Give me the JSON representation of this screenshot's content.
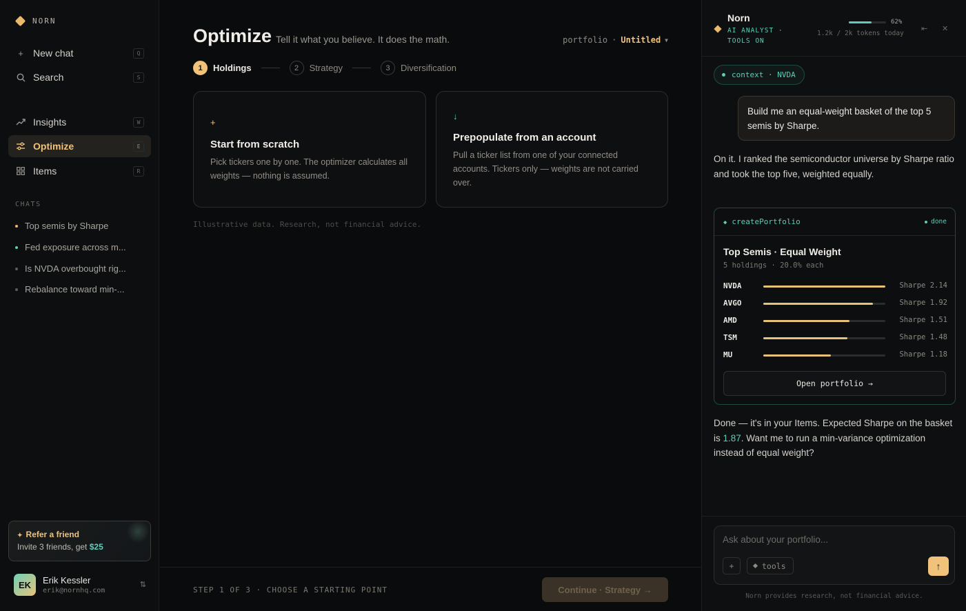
{
  "brand": {
    "name": "NORN"
  },
  "nav": {
    "new_chat": {
      "label": "New chat",
      "kbd": "Q"
    },
    "search": {
      "label": "Search",
      "kbd": "S"
    },
    "insights": {
      "label": "Insights",
      "kbd": "W"
    },
    "optimize": {
      "label": "Optimize",
      "kbd": "E"
    },
    "items": {
      "label": "Items",
      "kbd": "R"
    }
  },
  "chats": {
    "heading": "CHATS",
    "items": [
      {
        "label": "Top semis by Sharpe",
        "dot": "#e9b96e"
      },
      {
        "label": "Fed exposure across m...",
        "dot": "#5fcdb8"
      },
      {
        "label": "Is NVDA overbought rig...",
        "dot": "#5f5c57"
      },
      {
        "label": "Rebalance toward min-...",
        "dot": "#5f5c57"
      }
    ]
  },
  "refer": {
    "title": "Refer a friend",
    "text": "Invite 3 friends, get",
    "amount": "$25",
    "icon": "sparkle-icon"
  },
  "user": {
    "initials": "EK",
    "name": "Erik Kessler",
    "email": "erik@nornhq.com"
  },
  "main": {
    "title": "Optimize",
    "subtitle": "Tell it what you believe. It does the math.",
    "portfolio_label": "portfolio",
    "portfolio_sep": "·",
    "portfolio_name": "Untitled",
    "steps": [
      {
        "num": "1",
        "label": "Holdings"
      },
      {
        "num": "2",
        "label": "Strategy"
      },
      {
        "num": "3",
        "label": "Diversification"
      }
    ],
    "cards": [
      {
        "icon": "+",
        "title": "Start from scratch",
        "desc": "Pick tickers one by one. The optimizer calculates all weights — nothing is assumed."
      },
      {
        "icon": "↓",
        "title": "Prepopulate from an account",
        "desc": "Pull a ticker list from one of your connected accounts. Tickers only — weights are not carried over."
      }
    ],
    "disclaimer": "Illustrative data. Research, not financial advice.",
    "footer_text": "STEP 1 OF 3 · CHOOSE A STARTING POINT",
    "continue_label": "Continue · Strategy →"
  },
  "panel": {
    "name": "Norn",
    "role": "AI ANALYST · TOOLS ON",
    "usage_percent": 62,
    "usage_label": "62%",
    "tokens": "1.2k / 2k tokens today",
    "context_pill": "context · NVDA",
    "user_message": "Build me an equal-weight basket of the top 5 semis by Sharpe.",
    "ai_message_1": "On it. I ranked the semiconductor universe by Sharpe ratio and took the top five, weighted equally.",
    "tool": {
      "name": "createPortfolio",
      "status": "done",
      "portfolio_title": "Top Semis · Equal Weight",
      "portfolio_sub": "5 holdings · 20.0% each",
      "holdings": [
        {
          "ticker": "NVDA",
          "sharpe": 2.14,
          "sharpe_label": "Sharpe 2.14"
        },
        {
          "ticker": "AVGO",
          "sharpe": 1.92,
          "sharpe_label": "Sharpe 1.92"
        },
        {
          "ticker": "AMD",
          "sharpe": 1.51,
          "sharpe_label": "Sharpe 1.51"
        },
        {
          "ticker": "TSM",
          "sharpe": 1.48,
          "sharpe_label": "Sharpe 1.48"
        },
        {
          "ticker": "MU",
          "sharpe": 1.18,
          "sharpe_label": "Sharpe 1.18"
        }
      ],
      "open_label": "Open portfolio →"
    },
    "ai_message_2_pre": "Done — it's in your Items. Expected Sharpe on the basket is ",
    "ai_message_2_value": "1.87",
    "ai_message_2_post": ". Want me to run a min-variance optimization instead of equal weight?",
    "composer_placeholder": "Ask about your portfolio...",
    "plus_label": "+",
    "tools_label": "tools",
    "note": "Norn provides research, not financial advice."
  },
  "colors": {
    "accent": "#f0c27a",
    "teal": "#5fcdb8",
    "background": "#0b0c0e"
  }
}
